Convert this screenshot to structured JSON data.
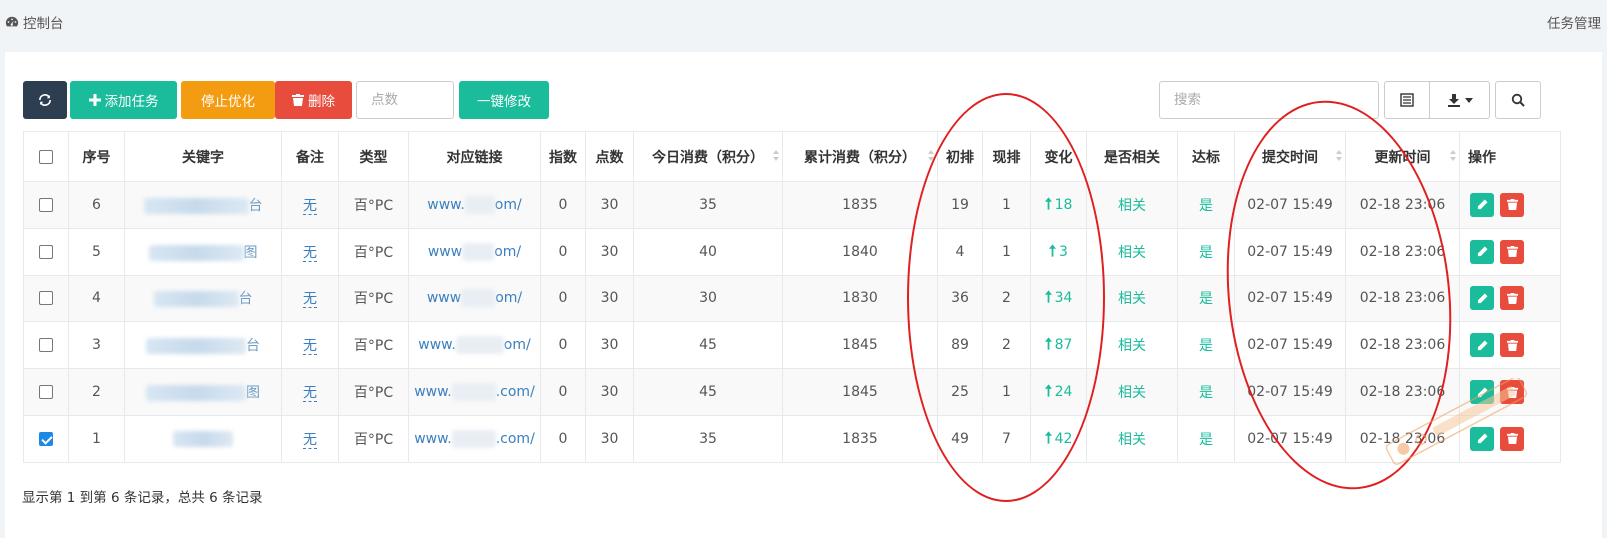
{
  "header": {
    "breadcrumb": "控制台",
    "right_title": "任务管理"
  },
  "toolbar": {
    "add_label": "添加任务",
    "stop_label": "停止优化",
    "delete_label": "删除",
    "points_placeholder": "点数",
    "modify_label": "一键修改",
    "search_placeholder": "搜索"
  },
  "table": {
    "columns": [
      "序号",
      "关键字",
      "备注",
      "类型",
      "对应链接",
      "指数",
      "点数",
      "今日消费（积分）",
      "累计消费（积分）",
      "初排",
      "现排",
      "变化",
      "是否相关",
      "达标",
      "提交时间",
      "更新时间",
      "操作"
    ],
    "rows": [
      {
        "id": "6",
        "kw_tail": "台",
        "note": "无",
        "type": "百°PC",
        "link_pre": "www.",
        "link_post": "om/",
        "index": "0",
        "points": "30",
        "today": "35",
        "total": "1835",
        "initial": "19",
        "current": "1",
        "change": "18",
        "related": "相关",
        "reached": "是",
        "submit": "02-07 15:49",
        "update": "02-18 23:06",
        "checked": false
      },
      {
        "id": "5",
        "kw_tail": "图",
        "note": "无",
        "type": "百°PC",
        "link_pre": "www",
        "link_post": "om/",
        "index": "0",
        "points": "30",
        "today": "40",
        "total": "1840",
        "initial": "4",
        "current": "1",
        "change": "3",
        "related": "相关",
        "reached": "是",
        "submit": "02-07 15:49",
        "update": "02-18 23:06",
        "checked": false
      },
      {
        "id": "4",
        "kw_tail": "台",
        "note": "无",
        "type": "百°PC",
        "link_pre": "www",
        "link_post": "om/",
        "index": "0",
        "points": "30",
        "today": "30",
        "total": "1830",
        "initial": "36",
        "current": "2",
        "change": "34",
        "related": "相关",
        "reached": "是",
        "submit": "02-07 15:49",
        "update": "02-18 23:06",
        "checked": false
      },
      {
        "id": "3",
        "kw_tail": "台",
        "note": "无",
        "type": "百°PC",
        "link_pre": "www.",
        "link_post": "om/",
        "index": "0",
        "points": "30",
        "today": "45",
        "total": "1845",
        "initial": "89",
        "current": "2",
        "change": "87",
        "related": "相关",
        "reached": "是",
        "submit": "02-07 15:49",
        "update": "02-18 23:06",
        "checked": false
      },
      {
        "id": "2",
        "kw_tail": "图",
        "note": "无",
        "type": "百°PC",
        "link_pre": "www.",
        "link_post": ".com/",
        "index": "0",
        "points": "30",
        "today": "45",
        "total": "1845",
        "initial": "25",
        "current": "1",
        "change": "24",
        "related": "相关",
        "reached": "是",
        "submit": "02-07 15:49",
        "update": "02-18 23:06",
        "checked": false
      },
      {
        "id": "1",
        "kw_tail": "",
        "note": "无",
        "type": "百°PC",
        "link_pre": "www.",
        "link_post": ".com/",
        "index": "0",
        "points": "30",
        "today": "35",
        "total": "1835",
        "initial": "49",
        "current": "7",
        "change": "42",
        "related": "相关",
        "reached": "是",
        "submit": "02-07 15:49",
        "update": "02-18 23:06",
        "checked": true
      }
    ]
  },
  "footer": {
    "info": "显示第 1 到第 6 条记录，总共 6 条记录"
  },
  "colors": {
    "primary": "#1abc9c",
    "warning": "#f39c12",
    "danger": "#e74c3c",
    "dark": "#2c3e50",
    "annotation": "#e02020"
  }
}
